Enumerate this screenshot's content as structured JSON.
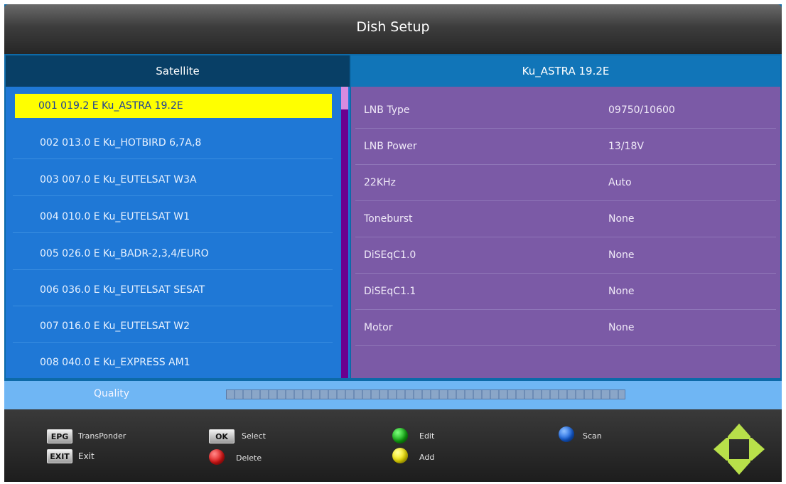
{
  "title": "Dish Setup",
  "left_panel": {
    "header": "Satellite",
    "satellites": [
      "001 019.2 E  Ku_ASTRA 19.2E",
      "002 013.0 E  Ku_HOTBIRD 6,7A,8",
      "003 007.0 E  Ku_EUTELSAT W3A",
      "004 010.0 E  Ku_EUTELSAT W1",
      "005 026.0 E  Ku_BADR-2,3,4/EURO",
      "006 036.0 E  Ku_EUTELSAT SESAT",
      "007 016.0 E  Ku_EUTELSAT W2",
      "008 040.0 E  Ku_EXPRESS AM1"
    ],
    "selected_index": 0
  },
  "right_panel": {
    "header": "Ku_ASTRA 19.2E",
    "settings": [
      {
        "label": "LNB Type",
        "value": "09750/10600"
      },
      {
        "label": "LNB Power",
        "value": "13/18V"
      },
      {
        "label": "22KHz",
        "value": "Auto"
      },
      {
        "label": "Toneburst",
        "value": "None"
      },
      {
        "label": "DiSEqC1.0",
        "value": "None"
      },
      {
        "label": "DiSEqC1.1",
        "value": "None"
      },
      {
        "label": "Motor",
        "value": "None"
      }
    ]
  },
  "quality": {
    "label": "Quality",
    "level": 0
  },
  "footer": {
    "epg_key": "EPG",
    "epg_label": "TransPonder",
    "exit_key": "EXIT",
    "exit_label": "Exit",
    "ok_key": "OK",
    "ok_label": "Select",
    "red_label": "Delete",
    "green_label": "Edit",
    "yellow_label": "Add",
    "blue_label": "Scan"
  },
  "colors": {
    "selection": "#ffff00",
    "left_bg": "#1f78d6",
    "right_bg": "#7b5aa6",
    "dpad": "#b8e04a"
  },
  "icons": {
    "red_button": "red-circle-icon",
    "green_button": "green-circle-icon",
    "yellow_button": "yellow-circle-icon",
    "blue_button": "blue-circle-icon",
    "navigation": "dpad-arrows-icon"
  }
}
